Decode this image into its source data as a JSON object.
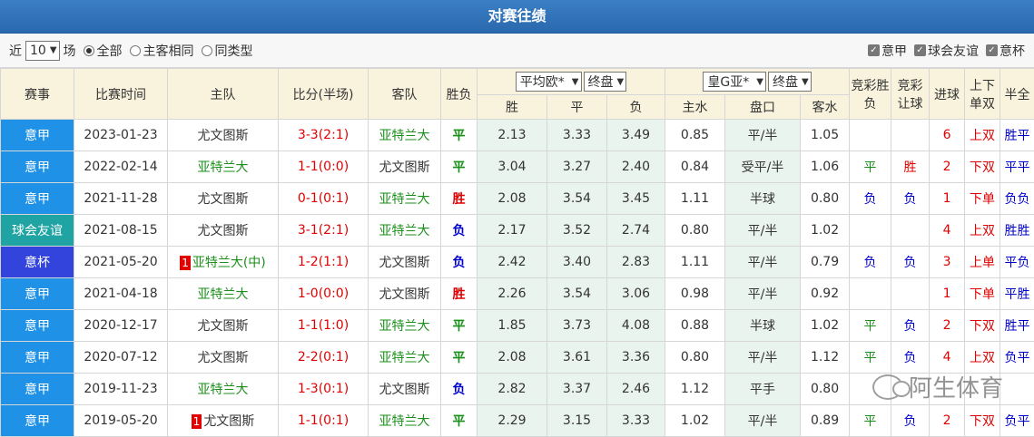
{
  "title": "对赛往绩",
  "filter": {
    "recent_prefix": "近",
    "recent_value": "10",
    "recent_suffix": "场",
    "radio_all": "全部",
    "radio_same_home": "主客相同",
    "radio_same_type": "同类型",
    "checks": [
      "意甲",
      "球会友谊",
      "意杯"
    ]
  },
  "header": {
    "league": "赛事",
    "time": "比赛时间",
    "home": "主队",
    "score": "比分(半场)",
    "away": "客队",
    "result": "胜负",
    "euro_select": "平均欧*",
    "euro_type": "终盘",
    "asia_select": "皇G亚*",
    "asia_type": "终盘",
    "jc_wl": "竞彩胜负",
    "jc_hc": "竞彩让球",
    "goals": "进球",
    "ou": "上下单双",
    "ht_ft": "半全",
    "sub": {
      "win": "胜",
      "draw": "平",
      "lose": "负",
      "home_water": "主水",
      "handicap": "盘口",
      "away_water": "客水"
    }
  },
  "rows": [
    {
      "league": "意甲",
      "lclass": "",
      "time": "2023-01-23",
      "home": "尤文图斯",
      "home_rank": "",
      "home_color": "",
      "score": "3-3(2:1)",
      "away": "亚特兰大",
      "away_color": "tgreen",
      "result": "平",
      "rclass": "res-ping",
      "w": "2.13",
      "d": "3.33",
      "l": "3.49",
      "hw": "0.85",
      "hc": "平/半",
      "aw": "1.05",
      "jc1": "",
      "jc1c": "",
      "jc2": "",
      "jc2c": "",
      "goals": "6",
      "ou": "上双",
      "htft": "胜平"
    },
    {
      "league": "意甲",
      "lclass": "",
      "time": "2022-02-14",
      "home": "亚特兰大",
      "home_rank": "",
      "home_color": "tgreen",
      "score": "1-1(0:0)",
      "away": "尤文图斯",
      "away_color": "",
      "result": "平",
      "rclass": "res-ping",
      "w": "3.04",
      "d": "3.27",
      "l": "2.40",
      "hw": "0.84",
      "hc": "受平/半",
      "aw": "1.06",
      "jc1": "平",
      "jc1c": "tgreen",
      "jc2": "胜",
      "jc2c": "tred",
      "goals": "2",
      "ou": "下双",
      "htft": "平平"
    },
    {
      "league": "意甲",
      "lclass": "",
      "time": "2021-11-28",
      "home": "尤文图斯",
      "home_rank": "",
      "home_color": "",
      "score": "0-1(0:1)",
      "away": "亚特兰大",
      "away_color": "tgreen",
      "result": "胜",
      "rclass": "res-sheng",
      "w": "2.08",
      "d": "3.54",
      "l": "3.45",
      "hw": "1.11",
      "hc": "半球",
      "aw": "0.80",
      "jc1": "负",
      "jc1c": "tblue",
      "jc2": "负",
      "jc2c": "tblue",
      "goals": "1",
      "ou": "下单",
      "htft": "负负"
    },
    {
      "league": "球会友谊",
      "lclass": "friendly",
      "time": "2021-08-15",
      "home": "尤文图斯",
      "home_rank": "",
      "home_color": "",
      "score": "3-1(2:1)",
      "away": "亚特兰大",
      "away_color": "tgreen",
      "result": "负",
      "rclass": "res-fu",
      "w": "2.17",
      "d": "3.52",
      "l": "2.74",
      "hw": "0.80",
      "hc": "平/半",
      "aw": "1.02",
      "jc1": "",
      "jc1c": "",
      "jc2": "",
      "jc2c": "",
      "goals": "4",
      "ou": "上双",
      "htft": "胜胜"
    },
    {
      "league": "意杯",
      "lclass": "cup",
      "time": "2021-05-20",
      "home": "亚特兰大(中)",
      "home_rank": "1",
      "home_color": "tgreen",
      "score": "1-2(1:1)",
      "away": "尤文图斯",
      "away_color": "",
      "result": "负",
      "rclass": "res-fu",
      "w": "2.42",
      "d": "3.40",
      "l": "2.83",
      "hw": "1.11",
      "hc": "平/半",
      "aw": "0.79",
      "jc1": "负",
      "jc1c": "tblue",
      "jc2": "负",
      "jc2c": "tblue",
      "goals": "3",
      "ou": "上单",
      "htft": "平负"
    },
    {
      "league": "意甲",
      "lclass": "",
      "time": "2021-04-18",
      "home": "亚特兰大",
      "home_rank": "",
      "home_color": "tgreen",
      "score": "1-0(0:0)",
      "away": "尤文图斯",
      "away_color": "",
      "result": "胜",
      "rclass": "res-sheng",
      "w": "2.26",
      "d": "3.54",
      "l": "3.06",
      "hw": "0.98",
      "hc": "平/半",
      "aw": "0.92",
      "jc1": "",
      "jc1c": "",
      "jc2": "",
      "jc2c": "",
      "goals": "1",
      "ou": "下单",
      "htft": "平胜"
    },
    {
      "league": "意甲",
      "lclass": "",
      "time": "2020-12-17",
      "home": "尤文图斯",
      "home_rank": "",
      "home_color": "",
      "score": "1-1(1:0)",
      "away": "亚特兰大",
      "away_color": "tgreen",
      "result": "平",
      "rclass": "res-ping",
      "w": "1.85",
      "d": "3.73",
      "l": "4.08",
      "hw": "0.88",
      "hc": "半球",
      "aw": "1.02",
      "jc1": "平",
      "jc1c": "tgreen",
      "jc2": "负",
      "jc2c": "tblue",
      "goals": "2",
      "ou": "下双",
      "htft": "胜平"
    },
    {
      "league": "意甲",
      "lclass": "",
      "time": "2020-07-12",
      "home": "尤文图斯",
      "home_rank": "",
      "home_color": "",
      "score": "2-2(0:1)",
      "away": "亚特兰大",
      "away_color": "tgreen",
      "result": "平",
      "rclass": "res-ping",
      "w": "2.08",
      "d": "3.61",
      "l": "3.36",
      "hw": "0.80",
      "hc": "平/半",
      "aw": "1.12",
      "jc1": "平",
      "jc1c": "tgreen",
      "jc2": "负",
      "jc2c": "tblue",
      "goals": "4",
      "ou": "上双",
      "htft": "负平"
    },
    {
      "league": "意甲",
      "lclass": "",
      "time": "2019-11-23",
      "home": "亚特兰大",
      "home_rank": "",
      "home_color": "tgreen",
      "score": "1-3(0:1)",
      "away": "尤文图斯",
      "away_color": "",
      "result": "负",
      "rclass": "res-fu",
      "w": "2.82",
      "d": "3.37",
      "l": "2.46",
      "hw": "1.12",
      "hc": "平手",
      "aw": "0.80",
      "jc1": "",
      "jc1c": "",
      "jc2": "",
      "jc2c": "",
      "goals": "",
      "ou": "",
      "htft": ""
    },
    {
      "league": "意甲",
      "lclass": "",
      "time": "2019-05-20",
      "home": "尤文图斯",
      "home_rank": "1",
      "home_color": "",
      "score": "1-1(0:1)",
      "away": "亚特兰大",
      "away_color": "tgreen",
      "result": "平",
      "rclass": "res-ping",
      "w": "2.29",
      "d": "3.15",
      "l": "3.33",
      "hw": "1.02",
      "hc": "平/半",
      "aw": "0.89",
      "jc1": "平",
      "jc1c": "tgreen",
      "jc2": "负",
      "jc2c": "tblue",
      "goals": "2",
      "ou": "下双",
      "htft": "负平"
    }
  ],
  "watermark": "阿生体育"
}
